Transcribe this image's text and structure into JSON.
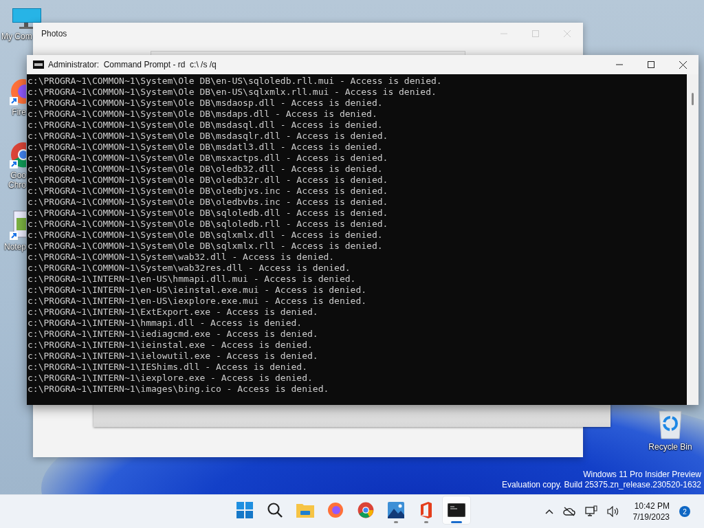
{
  "desktop_icons": [
    {
      "kind": "computer",
      "label": "My Com"
    },
    {
      "kind": "firefox",
      "label": "Fire"
    },
    {
      "kind": "chrome",
      "label": "Goo\nChro"
    },
    {
      "kind": "notepad",
      "label": "Notep"
    },
    {
      "kind": "recycle-bin",
      "label": "Recycle Bin"
    }
  ],
  "photos_window": {
    "title": "Photos"
  },
  "console_window": {
    "title": "Administrator:  Command Prompt - rd  c:\\ /s /q",
    "lines": [
      "c:\\PROGRA~1\\COMMON~1\\System\\Ole DB\\en-US\\sqloledb.rll.mui - Access is denied.",
      "c:\\PROGRA~1\\COMMON~1\\System\\Ole DB\\en-US\\sqlxmlx.rll.mui - Access is denied.",
      "c:\\PROGRA~1\\COMMON~1\\System\\Ole DB\\msdaosp.dll - Access is denied.",
      "c:\\PROGRA~1\\COMMON~1\\System\\Ole DB\\msdaps.dll - Access is denied.",
      "c:\\PROGRA~1\\COMMON~1\\System\\Ole DB\\msdasql.dll - Access is denied.",
      "c:\\PROGRA~1\\COMMON~1\\System\\Ole DB\\msdasqlr.dll - Access is denied.",
      "c:\\PROGRA~1\\COMMON~1\\System\\Ole DB\\msdatl3.dll - Access is denied.",
      "c:\\PROGRA~1\\COMMON~1\\System\\Ole DB\\msxactps.dll - Access is denied.",
      "c:\\PROGRA~1\\COMMON~1\\System\\Ole DB\\oledb32.dll - Access is denied.",
      "c:\\PROGRA~1\\COMMON~1\\System\\Ole DB\\oledb32r.dll - Access is denied.",
      "c:\\PROGRA~1\\COMMON~1\\System\\Ole DB\\oledbjvs.inc - Access is denied.",
      "c:\\PROGRA~1\\COMMON~1\\System\\Ole DB\\oledbvbs.inc - Access is denied.",
      "c:\\PROGRA~1\\COMMON~1\\System\\Ole DB\\sqloledb.dll - Access is denied.",
      "c:\\PROGRA~1\\COMMON~1\\System\\Ole DB\\sqloledb.rll - Access is denied.",
      "c:\\PROGRA~1\\COMMON~1\\System\\Ole DB\\sqlxmlx.dll - Access is denied.",
      "c:\\PROGRA~1\\COMMON~1\\System\\Ole DB\\sqlxmlx.rll - Access is denied.",
      "c:\\PROGRA~1\\COMMON~1\\System\\wab32.dll - Access is denied.",
      "c:\\PROGRA~1\\COMMON~1\\System\\wab32res.dll - Access is denied.",
      "c:\\PROGRA~1\\INTERN~1\\en-US\\hmmapi.dll.mui - Access is denied.",
      "c:\\PROGRA~1\\INTERN~1\\en-US\\ieinstal.exe.mui - Access is denied.",
      "c:\\PROGRA~1\\INTERN~1\\en-US\\iexplore.exe.mui - Access is denied.",
      "c:\\PROGRA~1\\INTERN~1\\ExtExport.exe - Access is denied.",
      "c:\\PROGRA~1\\INTERN~1\\hmmapi.dll - Access is denied.",
      "c:\\PROGRA~1\\INTERN~1\\iediagcmd.exe - Access is denied.",
      "c:\\PROGRA~1\\INTERN~1\\ieinstal.exe - Access is denied.",
      "c:\\PROGRA~1\\INTERN~1\\ielowutil.exe - Access is denied.",
      "c:\\PROGRA~1\\INTERN~1\\IEShims.dll - Access is denied.",
      "c:\\PROGRA~1\\INTERN~1\\iexplore.exe - Access is denied.",
      "c:\\PROGRA~1\\INTERN~1\\images\\bing.ico - Access is denied."
    ]
  },
  "watermark": {
    "lines": [
      "Windows 11 Pro Insider Preview",
      "Evaluation copy. Build 25375.zn_release.230520-1632"
    ]
  },
  "taskbar": {
    "apps": [
      {
        "kind": "start",
        "running": false,
        "selected": false
      },
      {
        "kind": "search",
        "running": false,
        "selected": false
      },
      {
        "kind": "folder",
        "running": false,
        "selected": false
      },
      {
        "kind": "firefox",
        "running": false,
        "selected": false
      },
      {
        "kind": "chrome",
        "running": false,
        "selected": false
      },
      {
        "kind": "photos",
        "running": true,
        "selected": false
      },
      {
        "kind": "office",
        "running": true,
        "selected": false
      },
      {
        "kind": "terminal",
        "running": true,
        "selected": true
      }
    ],
    "time": "10:42 PM",
    "date": "7/19/2023",
    "notification_count": "2"
  }
}
